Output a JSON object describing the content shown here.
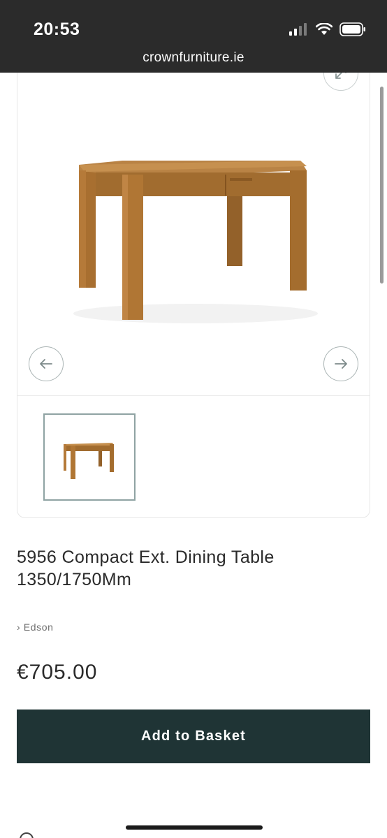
{
  "status_bar": {
    "time": "20:53",
    "icons": [
      "cellular-signal-icon",
      "wifi-icon",
      "battery-icon"
    ]
  },
  "browser": {
    "url": "crownfurniture.ie"
  },
  "gallery": {
    "main_image": "dining-table-image",
    "thumbnail": "dining-table-thumbnail",
    "icons": [
      "expand-icon",
      "arrow-left-icon",
      "arrow-right-icon"
    ]
  },
  "product": {
    "title_line1": "5956 Compact Ext. Dining Table",
    "title_line2": "1350/1750Mm",
    "brand_prefix": "›",
    "brand": "Edson",
    "price": "€705.00",
    "add_to_basket_label": "Add to Basket"
  },
  "colors": {
    "status_bar_bg": "#2b2b2b",
    "button_bg": "#1f3435",
    "button_text": "#ffffff",
    "thumbnail_border": "#8fa3a3",
    "wood": "#a5702f"
  }
}
